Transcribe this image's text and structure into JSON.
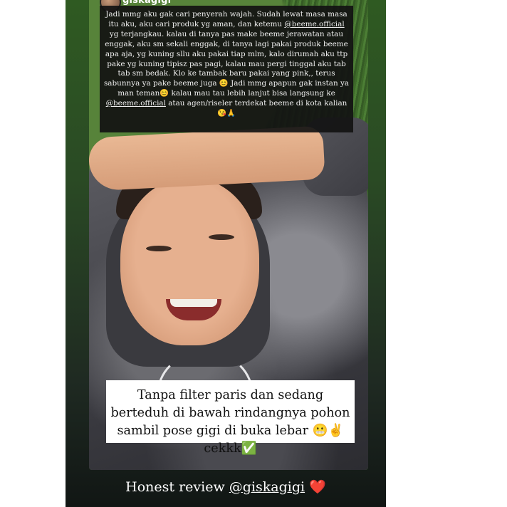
{
  "header": {
    "username": "giskagigi"
  },
  "top_caption": {
    "part1": "Jadi mmg aku gak cari penyerah wajah. Sudah lewat masa masa itu aku, aku cari produk yg aman, dan ketemu ",
    "mention1": "@beeme.official",
    "part2": " yg terjangkau. kalau di tanya pas make beeme jerawatan atau enggak, aku sm sekali enggak, di tanya lagi pakai produk beeme apa aja, yg kuning sllu aku pakai tiap mlm, kalo dirumah aku ttp pake yg kuning tipisz pas pagi, kalau mau pergi tinggal aku tab tab sm bedak. Klo ke tambak baru pakai yang pink,, terus sabunnya ya pake beeme juga 😊 Jadi mmg apapun gak instan ya man teman😊 kalau mau tau lebih lanjut bisa langsung ke ",
    "mention2": "@beeme.official",
    "part3": " atau agen/riseler terdekat beeme di kota kalian 😘🙏"
  },
  "bottom_caption": {
    "text": "Tanpa filter paris dan sedang berteduh di bawah rindangnya pohon sambil pose gigi di buka lebar 😬✌️ cekkk✅"
  },
  "footer": {
    "prefix": "Honest review ",
    "handle": "@giskagigi",
    "heart": "❤️"
  },
  "colors": {
    "caption_bg": "#121212",
    "heart": "#e0202a",
    "story_bg": "#2f5a22"
  },
  "icons": [
    "avatar",
    "heart-icon"
  ]
}
